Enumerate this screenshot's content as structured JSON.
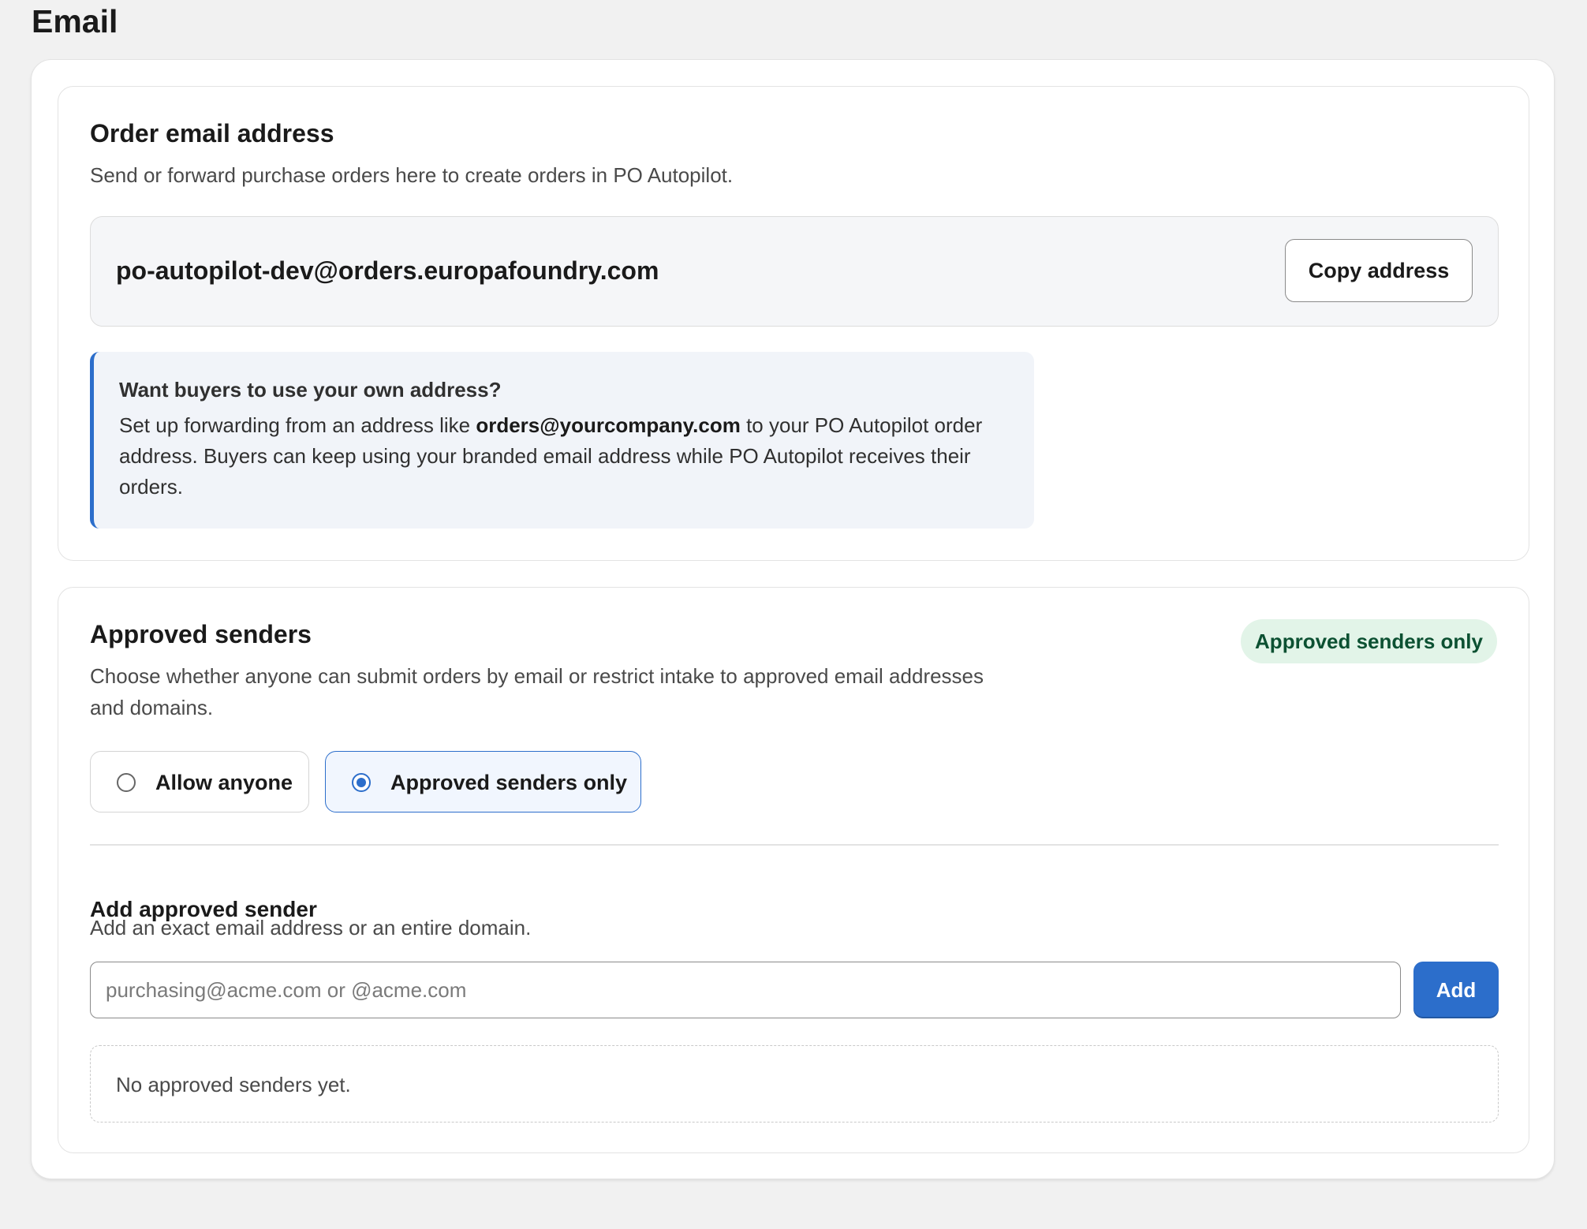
{
  "page": {
    "title": "Email"
  },
  "order_email": {
    "heading": "Order email address",
    "description": "Send or forward purchase orders here to create orders in PO Autopilot.",
    "address": "po-autopilot-dev@orders.europafoundry.com",
    "copy_button_label": "Copy address",
    "info": {
      "title": "Want buyers to use your own address?",
      "body_before": "Set up forwarding from an address like ",
      "example_address": "orders@yourcompany.com",
      "body_after": " to your PO Autopilot order address. Buyers can keep using your branded email address while PO Autopilot receives their orders.",
      "accent_color": "#2c6ecb"
    }
  },
  "approved_senders": {
    "heading": "Approved senders",
    "description": "Choose whether anyone can submit orders by email or restrict intake to approved email addresses and domains.",
    "status_badge": "Approved senders only",
    "badge_color": "#e2f4e8",
    "options": [
      {
        "label": "Allow anyone",
        "selected": false
      },
      {
        "label": "Approved senders only",
        "selected": true
      }
    ],
    "add_section": {
      "heading": "Add approved sender",
      "description": "Add an exact email address or an entire domain.",
      "input_value": "",
      "input_placeholder": "purchasing@acme.com or @acme.com",
      "add_button_label": "Add",
      "add_button_color": "#2c6ecb"
    },
    "empty_state": "No approved senders yet."
  }
}
